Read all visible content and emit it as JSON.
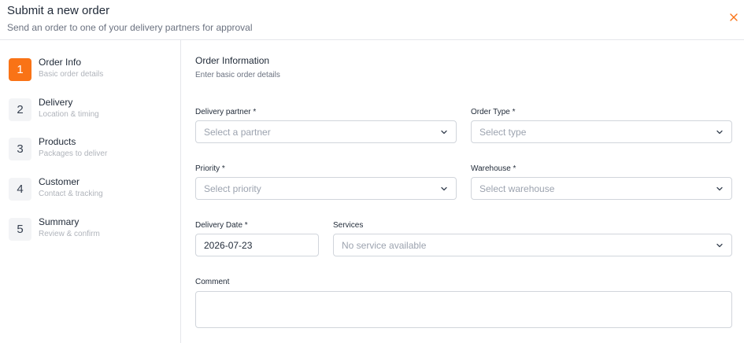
{
  "header": {
    "title": "Submit a new order",
    "subtitle": "Send an order to one of your delivery partners for approval"
  },
  "colors": {
    "accent": "#f97316",
    "close": "#f97316"
  },
  "steps": [
    {
      "number": "1",
      "label": "Order Info",
      "description": "Basic order details",
      "active": true
    },
    {
      "number": "2",
      "label": "Delivery",
      "description": "Location & timing",
      "active": false
    },
    {
      "number": "3",
      "label": "Products",
      "description": "Packages to deliver",
      "active": false
    },
    {
      "number": "4",
      "label": "Customer",
      "description": "Contact & tracking",
      "active": false
    },
    {
      "number": "5",
      "label": "Summary",
      "description": "Review & confirm",
      "active": false
    }
  ],
  "section": {
    "title": "Order Information",
    "subtitle": "Enter basic order details"
  },
  "fields": {
    "delivery_partner": {
      "label": "Delivery partner *",
      "placeholder": "Select a partner"
    },
    "order_type": {
      "label": "Order Type *",
      "placeholder": "Select type"
    },
    "priority": {
      "label": "Priority *",
      "placeholder": "Select priority"
    },
    "warehouse": {
      "label": "Warehouse *",
      "placeholder": "Select warehouse"
    },
    "delivery_date": {
      "label": "Delivery Date *",
      "value": "2026-07-23"
    },
    "services": {
      "label": "Services",
      "placeholder": "No service available"
    },
    "comment": {
      "label": "Comment",
      "value": ""
    }
  }
}
